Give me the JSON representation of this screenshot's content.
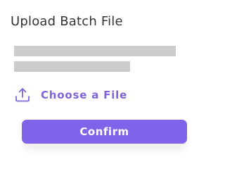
{
  "dialog": {
    "title": "Upload Batch File"
  },
  "upload": {
    "icon": "upload-icon",
    "choose_label": "Choose a File",
    "accent_color": "#7f63d9"
  },
  "actions": {
    "confirm_label": "Confirm",
    "confirm_color": "#7f63e8"
  }
}
